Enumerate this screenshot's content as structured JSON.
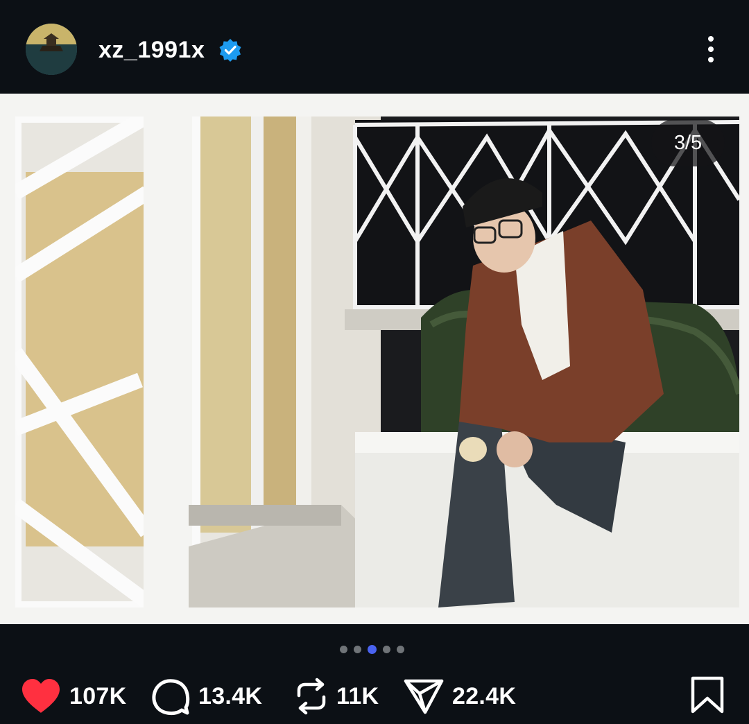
{
  "header": {
    "username": "xz_1991x",
    "verified": true,
    "avatar_icon": "avatar",
    "more_icon": "more-vertical-icon"
  },
  "post": {
    "counter": "3/5",
    "carousel": {
      "total": 5,
      "active_index": 2
    }
  },
  "actions": {
    "likes": "107K",
    "comments": "13.4K",
    "reposts": "11K",
    "shares": "22.4K",
    "like_icon": "heart-icon",
    "comment_icon": "comment-icon",
    "repost_icon": "repost-icon",
    "share_icon": "send-icon",
    "save_icon": "bookmark-icon"
  },
  "colors": {
    "background": "#0c1015",
    "like": "#ff3040",
    "verified": "#1d9bf0",
    "active_dot": "#4a63f0",
    "inactive_dot": "#707478"
  }
}
